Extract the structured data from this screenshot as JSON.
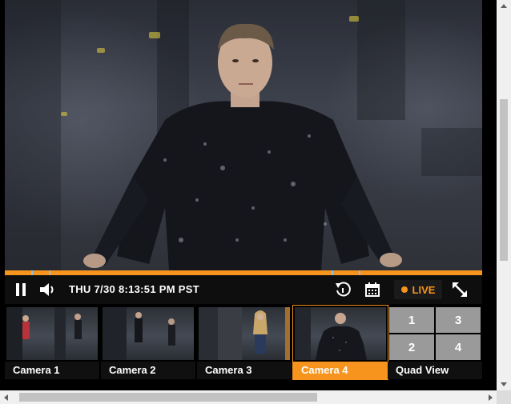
{
  "player": {
    "timestamp": "THU 7/30 8:13:51 PM PST",
    "live_label": "LIVE",
    "accent_color": "#f7941d",
    "progress_fraction": 1.0,
    "icons": [
      "pause-icon",
      "volume-icon",
      "replay-icon",
      "calendar-icon",
      "live-dot-icon",
      "fullscreen-icon"
    ]
  },
  "cameras": [
    {
      "label": "Camera 1",
      "active": false
    },
    {
      "label": "Camera 2",
      "active": false
    },
    {
      "label": "Camera 3",
      "active": false
    },
    {
      "label": "Camera 4",
      "active": true
    }
  ],
  "quad": {
    "label": "Quad View",
    "cells": [
      "1",
      "3",
      "2",
      "4"
    ]
  }
}
